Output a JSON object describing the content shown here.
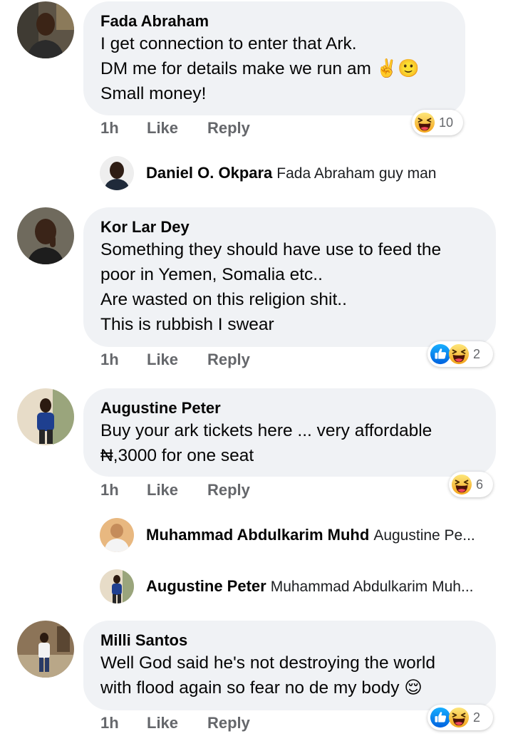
{
  "comments": [
    {
      "author": "Fada Abraham",
      "lines": [
        "I get connection to enter that Ark.",
        "DM me for details make we run am ✌️🙂",
        "Small money!"
      ],
      "time": "1h",
      "like_label": "Like",
      "reply_label": "Reply",
      "reaction_count": "10",
      "reactions": [
        "haha-icon"
      ],
      "replies": [
        {
          "author": "Daniel O. Okpara",
          "text": "Fada Abraham guy man"
        }
      ]
    },
    {
      "author": "Kor Lar Dey",
      "lines": [
        "Something they should have use to feed the",
        "poor in Yemen, Somalia etc..",
        "Are wasted on this religion shit..",
        "This is rubbish I swear"
      ],
      "time": "1h",
      "like_label": "Like",
      "reply_label": "Reply",
      "reaction_count": "2",
      "reactions": [
        "like-icon",
        "haha-icon"
      ]
    },
    {
      "author": "Augustine Peter",
      "lines": [
        "Buy your ark tickets here ... very affordable",
        "₦,3000 for one seat"
      ],
      "time": "1h",
      "like_label": "Like",
      "reply_label": "Reply",
      "reaction_count": "6",
      "reactions": [
        "haha-icon"
      ],
      "replies": [
        {
          "author": "Muhammad Abdulkarim Muhd",
          "text": "Augustine Pe..."
        },
        {
          "author": "Augustine Peter",
          "text": "Muhammad Abdulkarim Muh..."
        }
      ]
    },
    {
      "author": "Milli Santos",
      "lines": [
        "Well God said he's not destroying the world",
        "with flood again so fear no de my body 😌"
      ],
      "time": "1h",
      "like_label": "Like",
      "reply_label": "Reply",
      "reaction_count": "2",
      "reactions": [
        "like-icon",
        "haha-icon"
      ]
    }
  ],
  "colors": {
    "bubble": "#f0f2f5",
    "meta_text": "#65676b",
    "like_blue": "#1877f2",
    "haha_yellow": "#f7b125"
  }
}
